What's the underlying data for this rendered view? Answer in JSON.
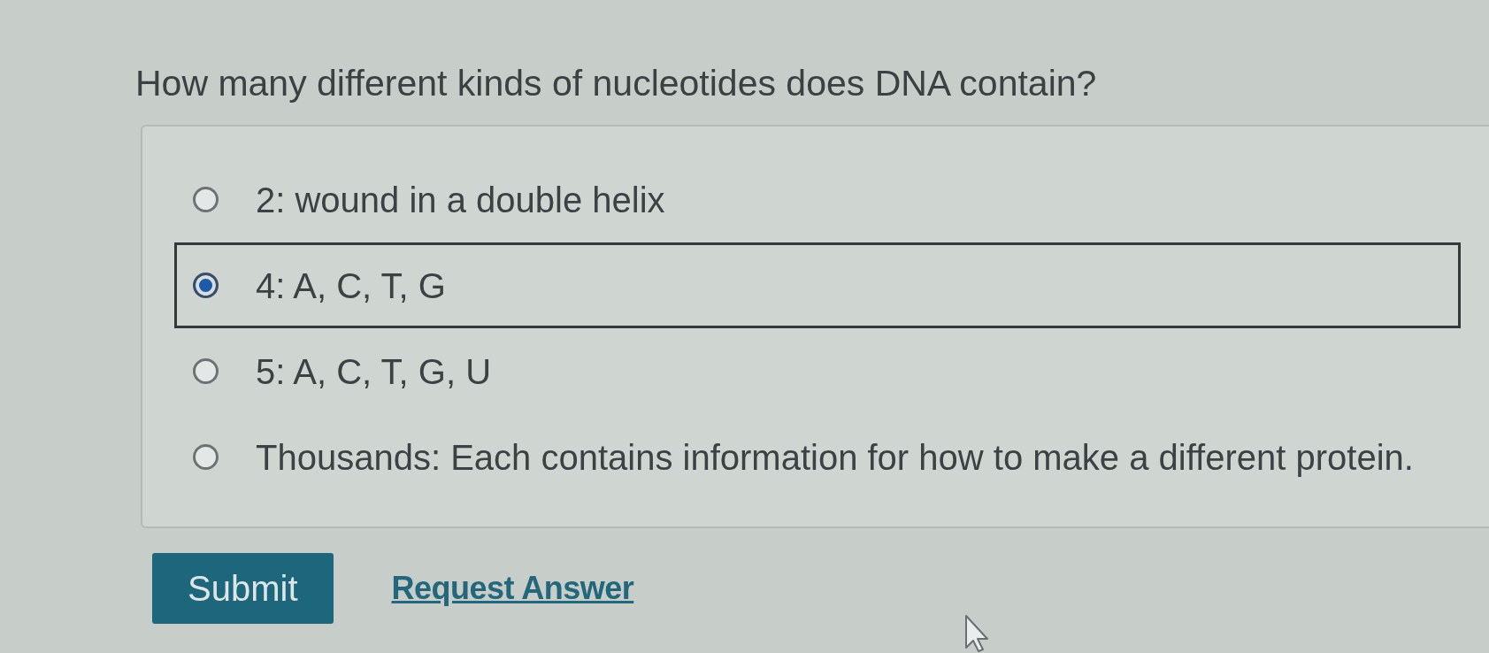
{
  "question": "How many different kinds of nucleotides does DNA contain?",
  "options": [
    {
      "label": "2: wound in a double helix",
      "selected": false
    },
    {
      "label": "4: A, C, T, G",
      "selected": true
    },
    {
      "label": "5: A, C, T, G, U",
      "selected": false
    },
    {
      "label": "Thousands: Each contains information for how to make a different protein.",
      "selected": false
    }
  ],
  "actions": [
    {
      "kind": "button",
      "label": "Submit"
    },
    {
      "kind": "link",
      "label": "Request Answer"
    }
  ]
}
